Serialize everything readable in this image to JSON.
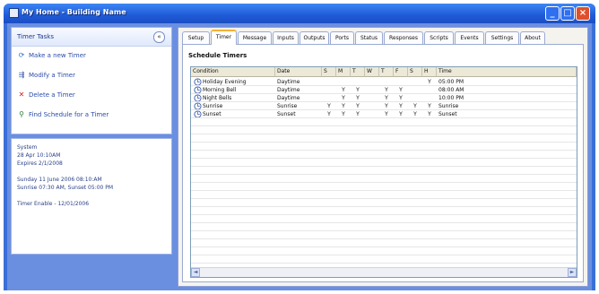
{
  "window": {
    "title": "My Home - Building Name",
    "min_label": "_",
    "max_label": "□",
    "close_label": "×"
  },
  "tasks": {
    "title": "Timer Tasks",
    "collapse": "«",
    "items": [
      {
        "label": "Make a new Timer",
        "icon": "new-timer-icon",
        "glyph": "⟳"
      },
      {
        "label": "Modify a Timer",
        "icon": "modify-timer-icon",
        "glyph": "⇶"
      },
      {
        "label": "Delete a Timer",
        "icon": "delete-icon",
        "glyph": "✕"
      },
      {
        "label": "Find Schedule for a Timer",
        "icon": "find-icon",
        "glyph": "⚲"
      }
    ]
  },
  "info": {
    "lines": [
      "System",
      "28 Apr 10:10AM",
      "Expires 2/1/2008",
      "",
      "Sunday 11 June 2006 08:10:AM",
      "Sunrise 07:30 AM, Sunset 05:00 PM",
      "",
      "Timer Enable - 12/01/2006"
    ]
  },
  "tabs": [
    "Setup",
    "Timer",
    "Message",
    "Inputs",
    "Outputs",
    "Ports",
    "Status",
    "Responses",
    "Scripts",
    "Events",
    "Settings",
    "About"
  ],
  "active_tab": 1,
  "main": {
    "section_title": "Schedule Timers"
  },
  "grid": {
    "headers": [
      "Condition",
      "Date",
      "S",
      "M",
      "T",
      "W",
      "T",
      "F",
      "S",
      "H",
      "Time"
    ],
    "rows": [
      {
        "name": "Holiday Evening",
        "date": "Daytime",
        "days": [
          "",
          "",
          "",
          "",
          "",
          "",
          "",
          "Y"
        ],
        "time": "05:00 PM"
      },
      {
        "name": "Morning Bell",
        "date": "Daytime",
        "days": [
          "",
          "Y",
          "Y",
          "",
          "Y",
          "Y",
          "",
          ""
        ],
        "time": "08:00 AM"
      },
      {
        "name": "Night Bells",
        "date": "Daytime",
        "days": [
          "",
          "Y",
          "Y",
          "",
          "Y",
          "Y",
          "",
          ""
        ],
        "time": "10:00 PM"
      },
      {
        "name": "Sunrise",
        "date": "Sunrise",
        "days": [
          "Y",
          "Y",
          "Y",
          "",
          "Y",
          "Y",
          "Y",
          "Y"
        ],
        "time": "Sunrise"
      },
      {
        "name": "Sunset",
        "date": "Sunset",
        "days": [
          "Y",
          "Y",
          "Y",
          "",
          "Y",
          "Y",
          "Y",
          "Y"
        ],
        "time": "Sunset"
      }
    ],
    "scroll_left": "◄",
    "scroll_right": "►"
  },
  "colors": {
    "titlebar": "#1f5ad6",
    "client_bg": "#6b8fe0",
    "tab_highlight": "#f3b23a",
    "close_button": "#e0502a"
  }
}
